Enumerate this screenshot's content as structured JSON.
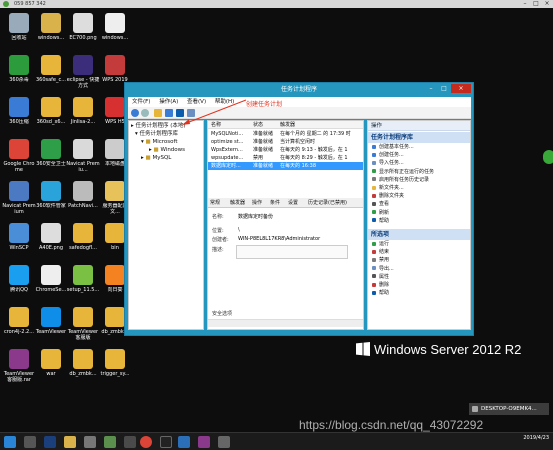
{
  "window_title": "059 857 342",
  "desktop_icons": [
    {
      "label": "回收站",
      "color": "#9ab"
    },
    {
      "label": "windows...",
      "color": "#d9b24c"
    },
    {
      "label": "EC700.png",
      "color": "#ddd"
    },
    {
      "label": "windows...",
      "color": "#eee"
    },
    {
      "label": "360杀毒",
      "color": "#2b9b3b"
    },
    {
      "label": "360safe_c...",
      "color": "#e6b53a"
    },
    {
      "label": "eclipse - 快捷方式",
      "color": "#3b2d7a"
    },
    {
      "label": "WPS 2019",
      "color": "#c43b3b"
    },
    {
      "label": "360压缩",
      "color": "#3a7bd5"
    },
    {
      "label": "360sd_x6...",
      "color": "#e6b53a"
    },
    {
      "label": "Jinlisa-2...",
      "color": "#e6b53a"
    },
    {
      "label": "WPS H5",
      "color": "#d63031"
    },
    {
      "label": "Google Chrome",
      "color": "#db4437"
    },
    {
      "label": "360安全卫士",
      "color": "#2e9e48"
    },
    {
      "label": "Navicat Premiu...",
      "color": "#d9d9d9"
    },
    {
      "label": "本地磁盘",
      "color": "#ccc"
    },
    {
      "label": "Navicat Premium",
      "color": "#4b79c2"
    },
    {
      "label": "360软件管家",
      "color": "#29a3d9"
    },
    {
      "label": "PatchNavi...",
      "color": "#bbb"
    },
    {
      "label": "服务器配置文...",
      "color": "#e7c25a"
    },
    {
      "label": "WinSCP",
      "color": "#4a8ed8"
    },
    {
      "label": "A40E.png",
      "color": "#ddd"
    },
    {
      "label": "safedogfl...",
      "color": "#e6b53a"
    },
    {
      "label": "bin",
      "color": "#e6b53a"
    },
    {
      "label": "腾讯QQ",
      "color": "#1a9ef0"
    },
    {
      "label": "ChromeSe...",
      "color": "#eee"
    },
    {
      "label": "setup_11.5...",
      "color": "#7ac143"
    },
    {
      "label": "向日葵",
      "color": "#f58220"
    },
    {
      "label": "cron4j-2.2...",
      "color": "#e6b53a"
    },
    {
      "label": "TeamViewer",
      "color": "#0e8ee9"
    },
    {
      "label": "TeamViewer 客服版",
      "color": "#e6b53a"
    },
    {
      "label": "db_zmbk...",
      "color": "#e6b53a"
    },
    {
      "label": "TeamViewer 客服版.rar",
      "color": "#8b3a8b"
    },
    {
      "label": "war",
      "color": "#e6b53a"
    },
    {
      "label": "db_zmbk...",
      "color": "#e6b53a"
    },
    {
      "label": "trigger_sy...",
      "color": "#e6b53a"
    }
  ],
  "app": {
    "title": "任务计划程序",
    "menu": [
      "文件(F)",
      "操作(A)",
      "查看(V)",
      "帮助(H)"
    ],
    "annotation": "创建任务计划",
    "tree": [
      "任务计划程序 (本地)",
      "任务计划程序库",
      "Microsoft",
      "Windows",
      "MySQL"
    ],
    "list": {
      "headers": [
        "名称",
        "状态",
        "触发器"
      ],
      "rows": [
        {
          "name": "MySQLNoti...",
          "status": "准备就绪",
          "trigger": "在每个月的 星期二 的 17:39 时"
        },
        {
          "name": "optimize st...",
          "status": "准备就绪",
          "trigger": "当计算机空闲时"
        },
        {
          "name": "WpsExtern...",
          "status": "准备就绪",
          "trigger": "在每天的 9:13 - 触发后，在 1"
        },
        {
          "name": "wpsupdate...",
          "status": "禁用",
          "trigger": "在每天的 8:29 - 触发后，在 1"
        },
        {
          "name": "数据库定时...",
          "status": "准备就绪",
          "trigger": "在每天的 16:38"
        }
      ]
    },
    "tabs": [
      "常规",
      "触发器",
      "操作",
      "条件",
      "设置",
      "历史记录(已禁用)"
    ],
    "props": {
      "name_label": "名称:",
      "name_value": "数据库定时备份",
      "location_label": "位置:",
      "location_value": "\\",
      "author_label": "创建者:",
      "author_value": "WIN-P8EL8L17KR8\\Administrator",
      "desc_label": "描述:",
      "security_label": "安全选项"
    },
    "actions_header": "操作",
    "sections": [
      {
        "title": "任务计划程序库",
        "items": [
          "创建基本任务...",
          "创建任务...",
          "导入任务...",
          "显示所有正在运行的任务",
          "启用所有任务历史记录",
          "新文件夹...",
          "删除文件夹",
          "查看",
          "刷新",
          "帮助"
        ]
      },
      {
        "title": "所选项",
        "items": [
          "运行",
          "结束",
          "禁用",
          "导出...",
          "属性",
          "删除",
          "帮助"
        ]
      }
    ]
  },
  "branding": "Windows Server 2012 R2",
  "desktop_label": "DESKTOP-O9EMK4...",
  "watermark": "https://blog.csdn.net/qq_43072292",
  "clock": {
    "time": "",
    "date": "2019/4/23"
  }
}
